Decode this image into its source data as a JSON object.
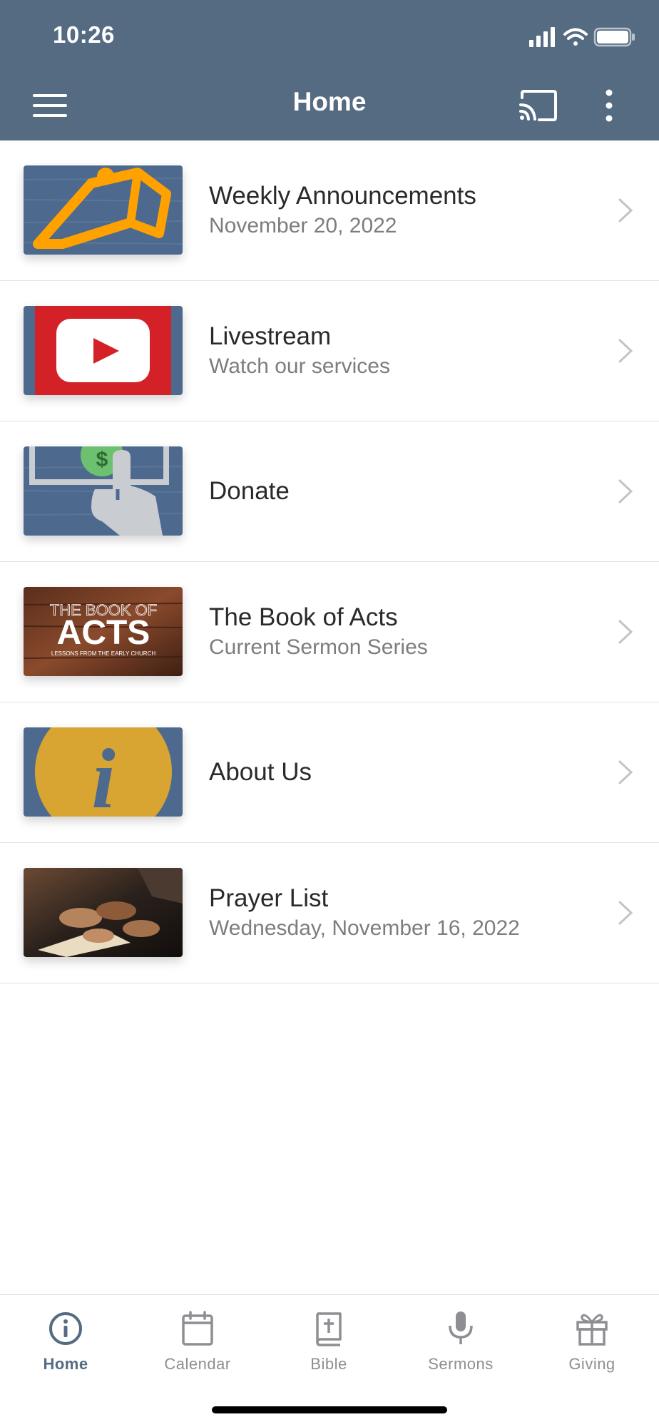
{
  "status_bar": {
    "time": "10:26"
  },
  "nav": {
    "title": "Home"
  },
  "items": [
    {
      "title": "Weekly Announcements",
      "subtitle": "November 20, 2022"
    },
    {
      "title": "Livestream",
      "subtitle": "Watch our services"
    },
    {
      "title": "Donate"
    },
    {
      "title": "The Book of Acts",
      "subtitle": "Current Sermon Series",
      "thumb_text": {
        "top": "THE BOOK OF",
        "main": "ACTS",
        "bottom": "LESSONS FROM THE EARLY CHURCH"
      }
    },
    {
      "title": "About Us"
    },
    {
      "title": "Prayer List",
      "subtitle": "Wednesday, November 16, 2022"
    }
  ],
  "thumb_symbols": {
    "donate": "$",
    "about": "i"
  },
  "tabs": [
    {
      "label": "Home",
      "icon": "info-circle-icon",
      "active": true
    },
    {
      "label": "Calendar",
      "icon": "calendar-icon",
      "active": false
    },
    {
      "label": "Bible",
      "icon": "bible-icon",
      "active": false
    },
    {
      "label": "Sermons",
      "icon": "microphone-icon",
      "active": false
    },
    {
      "label": "Giving",
      "icon": "gift-icon",
      "active": false
    }
  ],
  "colors": {
    "header": "#546b82",
    "accent": "#546b82",
    "inactive_tab": "#8e8e93",
    "announce_orange": "#ffa200",
    "youtube_red": "#d32127",
    "info_gold": "#d9a532"
  }
}
